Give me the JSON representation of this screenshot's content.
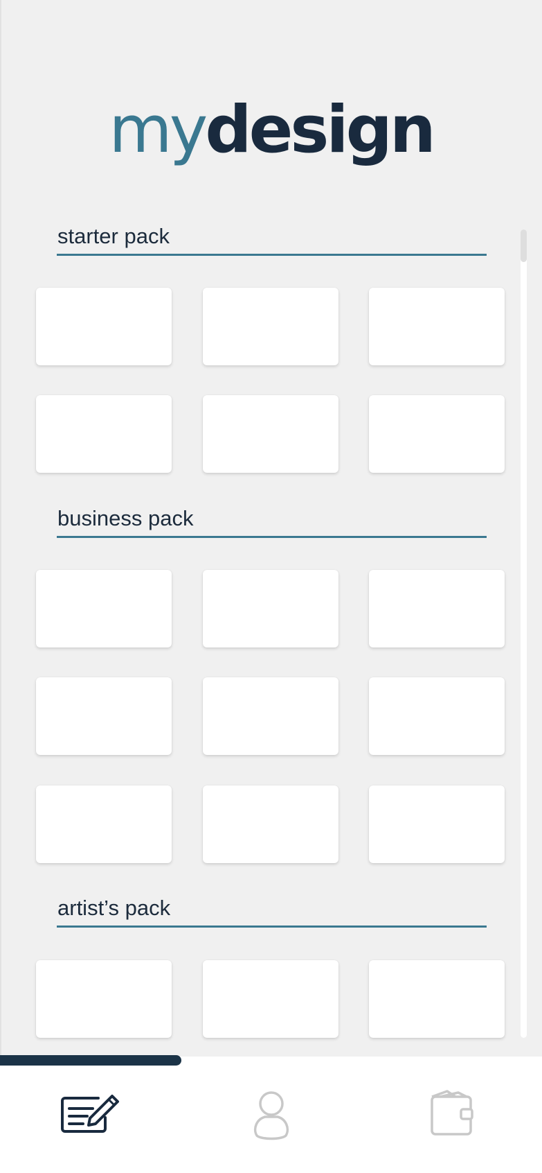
{
  "app": {
    "logo_light": "my",
    "logo_bold": "design"
  },
  "colors": {
    "accent": "#3a7890",
    "dark": "#192a3e",
    "background": "#f0f0f0",
    "card": "#ffffff",
    "inactive_icon": "#c8c8c8"
  },
  "packs": [
    {
      "title": "starter pack",
      "rows": 2,
      "columns": 3
    },
    {
      "title": "business pack",
      "rows": 3,
      "columns": 3
    },
    {
      "title": "artist’s pack",
      "rows": 1,
      "columns": 3
    }
  ],
  "bottom_nav": [
    {
      "icon": "edit-icon",
      "active": true
    },
    {
      "icon": "profile-icon",
      "active": false
    },
    {
      "icon": "wallet-icon",
      "active": false
    }
  ]
}
